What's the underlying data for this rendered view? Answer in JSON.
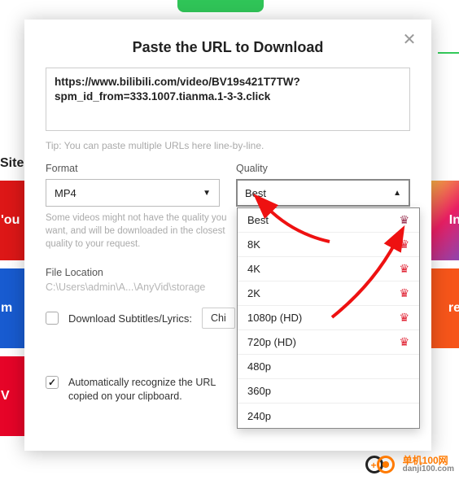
{
  "background": {
    "sites_label": "Sites",
    "tiles": {
      "yt": "'ou",
      "ig": "In",
      "fb": "m",
      "rd": "re",
      "vb": "V"
    }
  },
  "dialog": {
    "title": "Paste the URL to Download",
    "url_value": "https://www.bilibili.com/video/BV19s421T7TW?spm_id_from=333.1007.tianma.1-3-3.click",
    "tip": "Tip: You can paste multiple URLs here line-by-line.",
    "format": {
      "label": "Format",
      "value": "MP4",
      "note": "Some videos might not have the quality you want, and will be downloaded in the closest quality to your request."
    },
    "quality": {
      "label": "Quality",
      "value": "Best",
      "options": [
        {
          "label": "Best",
          "crown": true,
          "crown_alt": true
        },
        {
          "label": "8K",
          "crown": true
        },
        {
          "label": "4K",
          "crown": true
        },
        {
          "label": "2K",
          "crown": true
        },
        {
          "label": "1080p (HD)",
          "crown": true
        },
        {
          "label": "720p (HD)",
          "crown": true
        },
        {
          "label": "480p",
          "crown": false
        },
        {
          "label": "360p",
          "crown": false
        },
        {
          "label": "240p",
          "crown": false
        }
      ]
    },
    "file_location": {
      "label": "File Location",
      "value": "C:\\Users\\admin\\A...\\AnyVid\\storage"
    },
    "subtitles": {
      "checked": false,
      "label": "Download Subtitles/Lyrics:",
      "lang_button": "Chinese"
    },
    "auto_recognize": {
      "checked": true,
      "label": "Automatically recognize the URL copied on your clipboard."
    }
  },
  "watermark": {
    "cn": "单机100网",
    "en": "danji100.com"
  }
}
